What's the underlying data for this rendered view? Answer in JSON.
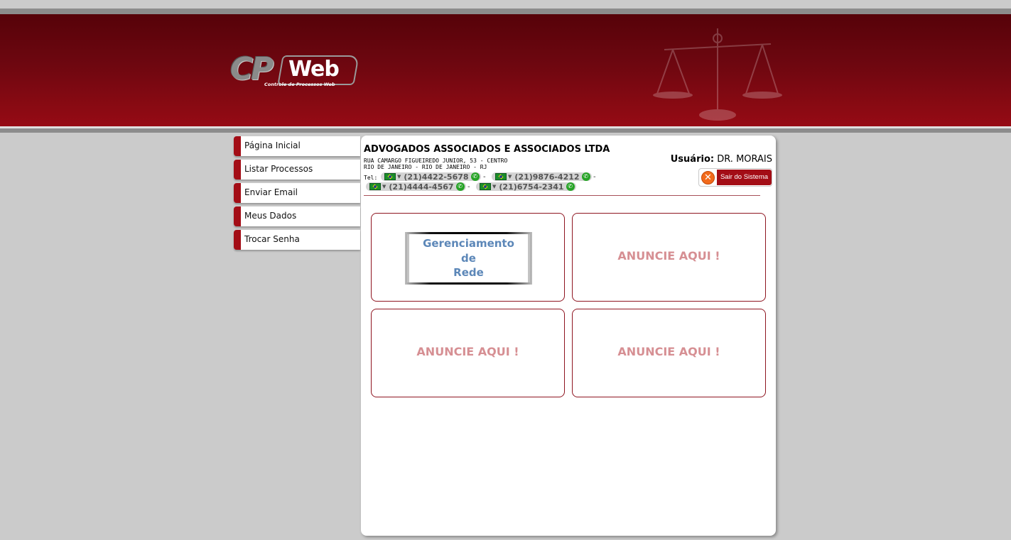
{
  "brand": {
    "logo_cp": "CP",
    "logo_web": "Web",
    "logo_tagline": "Controle de Processos Web"
  },
  "nav": {
    "items": [
      {
        "label": "Página Inicial"
      },
      {
        "label": "Listar Processos"
      },
      {
        "label": "Enviar Email"
      },
      {
        "label": "Meus Dados"
      },
      {
        "label": "Trocar Senha"
      }
    ]
  },
  "company": {
    "name": "ADVOGADOS ASSOCIADOS E ASSOCIADOS LTDA",
    "address_line1": "RUA CAMARGO FIGUEIREDO JUNIOR, 53 - CENTRO",
    "address_line2": "RIO DE JANEIRO - RIO DE JANEIRO - RJ",
    "tel_label": "Tel:",
    "phones": [
      "(21)4422-5678",
      "(21)9876-4212",
      "(21)4444-4567",
      "(21)6754-2341"
    ],
    "phone_separator": "-"
  },
  "user": {
    "label": "Usuário:",
    "name": "DR. MORAIS",
    "logout_label": "Sair do Sistema"
  },
  "ads": {
    "banner_lines": [
      "Gerenciamento",
      "de",
      "Rede"
    ],
    "placeholder": "ANUNCIE AQUI !"
  },
  "colors": {
    "header_dark": "#560209",
    "header_light": "#960b14",
    "accent": "#a30d16",
    "ad_text": "#d68f93",
    "banner_text": "#5c87b8"
  },
  "icons": {
    "logout": "close-circle-icon",
    "phone_call": "phone-call-icon",
    "flag": "brazil-flag-icon"
  }
}
